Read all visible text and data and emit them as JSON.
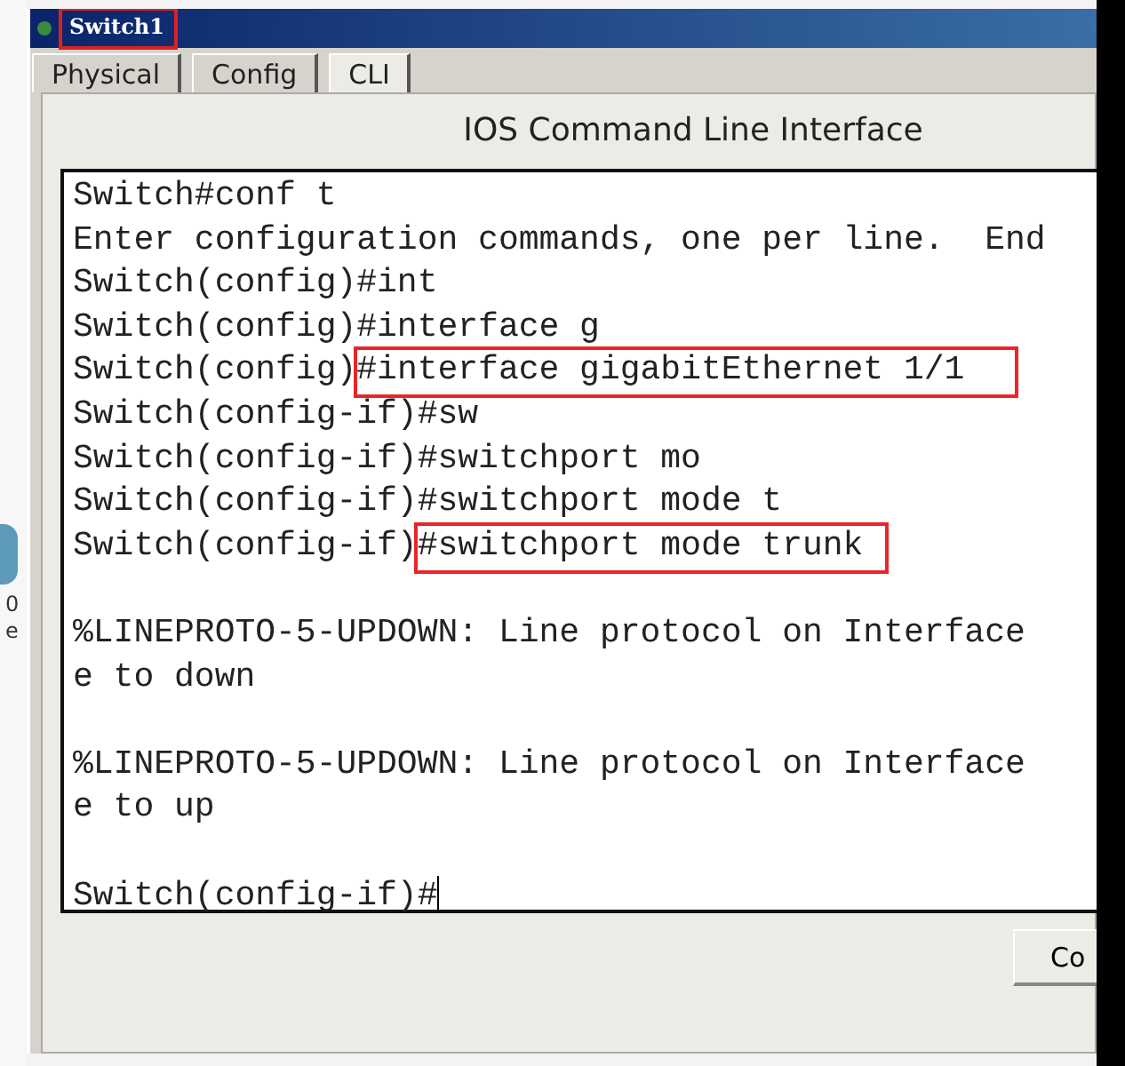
{
  "desktop": {
    "labels": [
      "0",
      "e"
    ]
  },
  "window": {
    "title": "Switch1",
    "title_highlighted": true
  },
  "tabs": [
    {
      "label": "Physical",
      "selected": false
    },
    {
      "label": "Config",
      "selected": false
    },
    {
      "label": "CLI",
      "selected": true
    }
  ],
  "heading": "IOS Command Line Interface",
  "terminal": {
    "lines": [
      {
        "prompt": "Switch#conf t"
      },
      {
        "prompt": "Enter configuration commands, one per line.  End"
      },
      {
        "prompt": "Switch(config)#int"
      },
      {
        "prompt": "Switch(config)#interface g"
      },
      {
        "prompt": "Switch(config)",
        "command": "#interface gigabitEthernet 1/1",
        "highlighted": true
      },
      {
        "prompt": "Switch(config-if)#sw"
      },
      {
        "prompt": "Switch(config-if)#switchport mo"
      },
      {
        "prompt": "Switch(config-if)#switchport mode t"
      },
      {
        "prompt": "Switch(config-if)",
        "command": "#switchport mode trunk",
        "highlighted": true
      },
      {
        "prompt": "%LINEPROTO-5-UPDOWN: Line protocol on Interface",
        "blank_before": true
      },
      {
        "prompt": "e to down"
      },
      {
        "prompt": "%LINEPROTO-5-UPDOWN: Line protocol on Interface",
        "blank_before": true
      },
      {
        "prompt": "e to up"
      },
      {
        "prompt": "Switch(config-if)#",
        "cursor": true,
        "blank_before": true
      }
    ]
  },
  "copy_button": "Co"
}
